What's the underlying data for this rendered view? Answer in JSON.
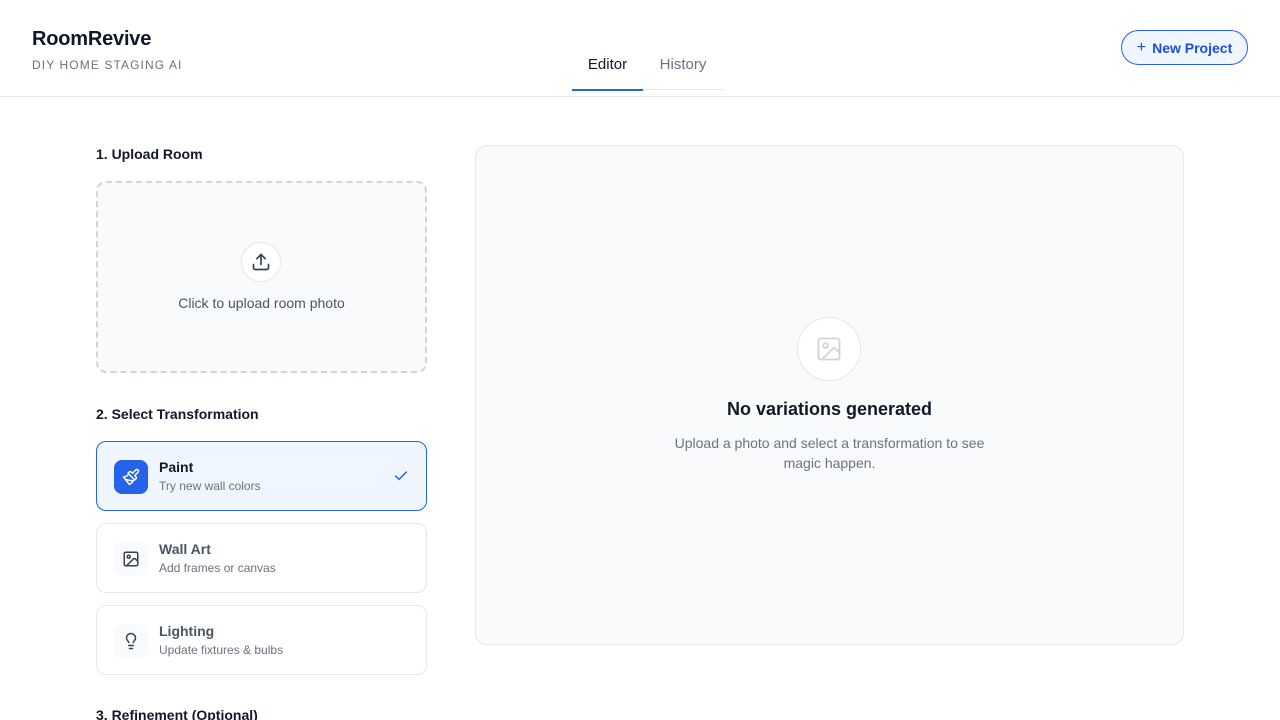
{
  "header": {
    "title": "RoomRevive",
    "subtitle": "DIY HOME STAGING AI",
    "tabs": [
      {
        "label": "Editor",
        "active": true
      },
      {
        "label": "History",
        "active": false
      }
    ],
    "new_project_label": "New Project"
  },
  "sections": {
    "upload_title": "1. Upload Room",
    "upload_prompt": "Click to upload room photo",
    "transform_title": "2. Select Transformation",
    "refine_title": "3. Refinement (Optional)"
  },
  "transformations": [
    {
      "title": "Paint",
      "desc": "Try new wall colors",
      "icon": "paintbrush-icon",
      "selected": true
    },
    {
      "title": "Wall Art",
      "desc": "Add frames or canvas",
      "icon": "image-icon",
      "selected": false
    },
    {
      "title": "Lighting",
      "desc": "Update fixtures & bulbs",
      "icon": "lightbulb-icon",
      "selected": false
    }
  ],
  "preview": {
    "title": "No variations generated",
    "desc": "Upload a photo and select a transformation to see magic happen."
  },
  "colors": {
    "accent": "#2563eb",
    "accent_bg": "#eff6ff",
    "border": "#e5e7eb",
    "muted_text": "#6b7280"
  }
}
